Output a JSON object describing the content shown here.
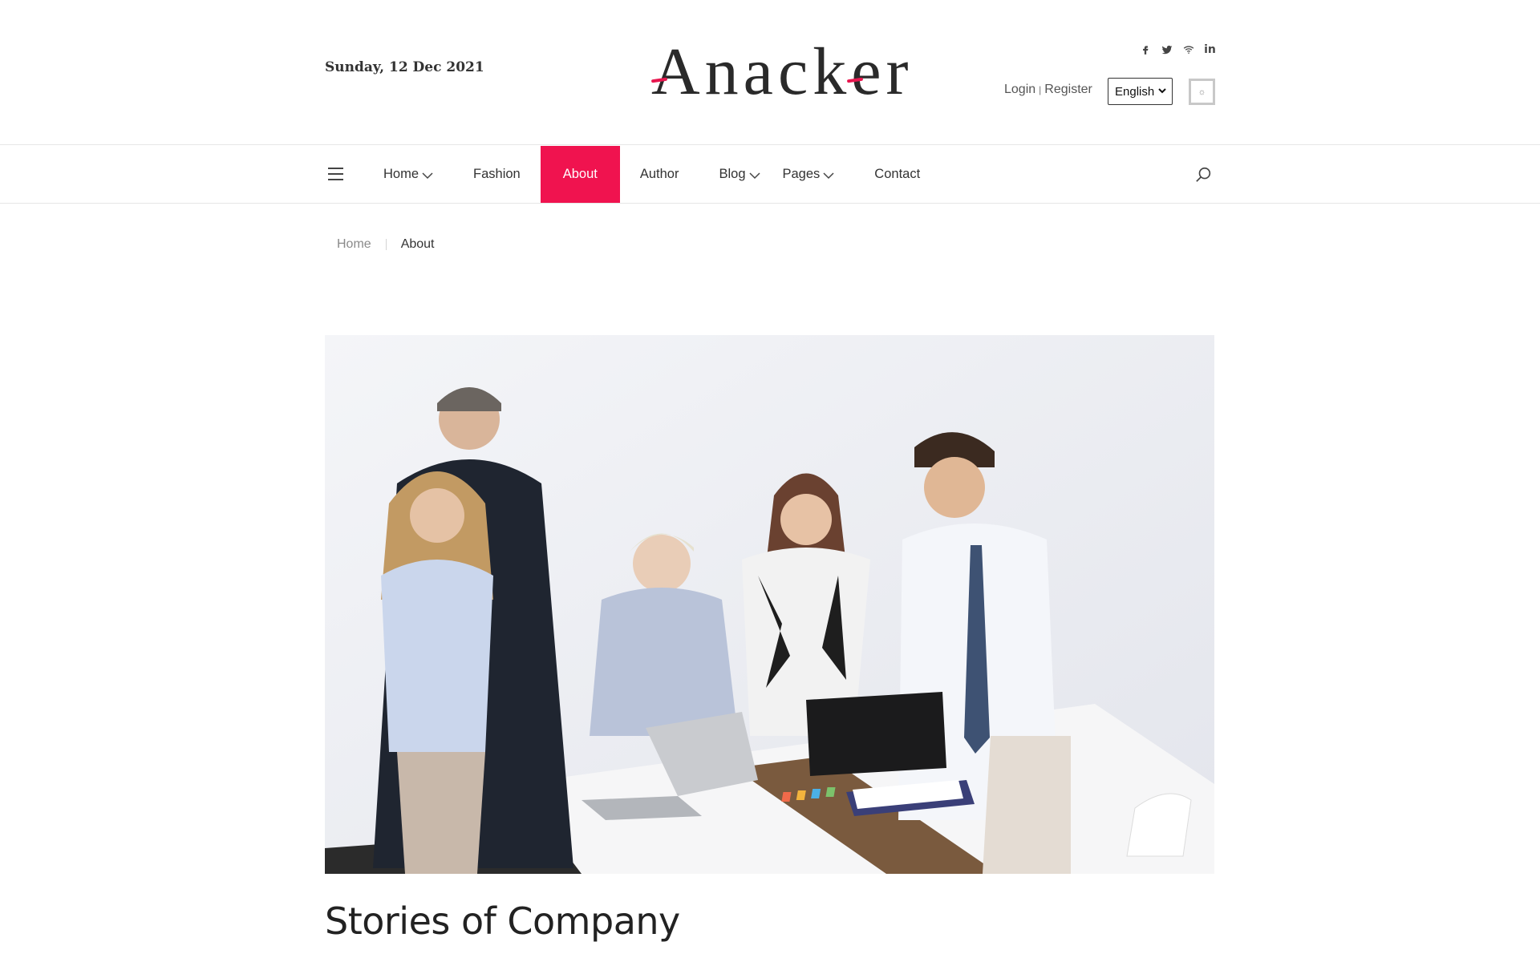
{
  "header": {
    "date": "Sunday, 12 Dec 2021",
    "logo_text": "Anacker",
    "social": [
      {
        "icon": "facebook-icon",
        "label": "f"
      },
      {
        "icon": "twitter-icon",
        "label": ""
      },
      {
        "icon": "wifi-icon",
        "label": ""
      },
      {
        "icon": "linkedin-icon",
        "label": "in"
      }
    ],
    "login_label": "Login",
    "auth_separator": "|",
    "register_label": "Register",
    "language": "English",
    "theme_toggle_symbol": "☼"
  },
  "nav": {
    "items": [
      {
        "label": "Home",
        "dropdown": true
      },
      {
        "label": "Fashion",
        "dropdown": false
      },
      {
        "label": "About",
        "dropdown": false,
        "active": true
      },
      {
        "label": "Author",
        "dropdown": false
      },
      {
        "label": "Blog",
        "dropdown": true
      },
      {
        "label": "Pages",
        "dropdown": true
      },
      {
        "label": "Contact",
        "dropdown": false
      }
    ],
    "accent_color": "#f0134f"
  },
  "breadcrumb": {
    "home": "Home",
    "current": "About"
  },
  "main": {
    "title": "Stories of Company"
  }
}
